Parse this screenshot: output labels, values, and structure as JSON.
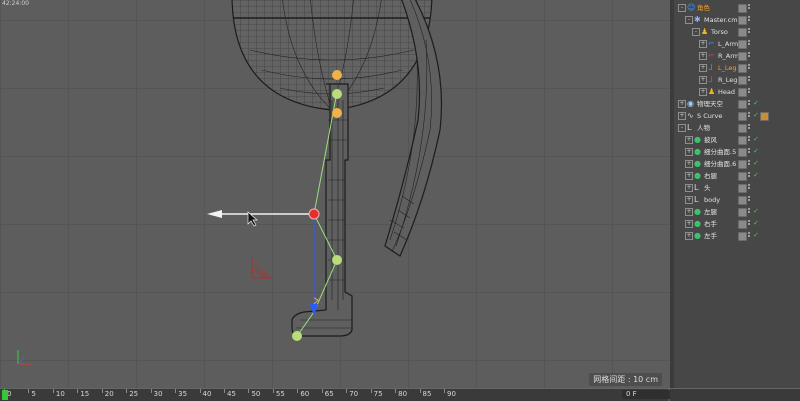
{
  "viewport": {
    "info": "42:24:00",
    "grid_spacing_text": "网格间距 : 10 cm"
  },
  "objects": [
    {
      "label": "角色",
      "color": "#f0a030",
      "icon": "figure-icon",
      "icon_color": "#3aa0ff",
      "depth": 0,
      "expanded": true
    },
    {
      "label": "Master.cmp",
      "color": "#e2e2e2",
      "icon": "star-icon",
      "icon_color": "#8fb6ff",
      "depth": 1,
      "expanded": true
    },
    {
      "label": "Torso",
      "color": "#e2e2e2",
      "icon": "joint-icon",
      "icon_color": "#f4b023",
      "depth": 2,
      "expanded": true
    },
    {
      "label": "L_Arm",
      "color": "#e2e2e2",
      "icon": "limb-icon",
      "icon_color": "#3b8cff",
      "depth": 3
    },
    {
      "label": "R_Arm",
      "color": "#e2e2e2",
      "icon": "limb-icon",
      "icon_color": "#e84040",
      "depth": 3
    },
    {
      "label": "L_Leg",
      "color": "#f0a030",
      "icon": "leg-icon",
      "icon_color": "#3b8cff",
      "depth": 3
    },
    {
      "label": "R_Leg",
      "color": "#e2e2e2",
      "icon": "leg-icon",
      "icon_color": "#e84040",
      "depth": 3
    },
    {
      "label": "Head",
      "color": "#e2e2e2",
      "icon": "joint-icon",
      "icon_color": "#f4b023",
      "depth": 3
    },
    {
      "label": "物理天空",
      "color": "#e2e2e2",
      "icon": "sky-icon",
      "icon_color": "#9fd0ff",
      "depth": 0,
      "check": true
    },
    {
      "label": "S Curve",
      "color": "#e2e2e2",
      "icon": "spline-icon",
      "icon_color": "#cfcfcf",
      "depth": 0,
      "check": true,
      "extra": true
    },
    {
      "label": "人物",
      "color": "#e2e2e2",
      "icon": "null-icon",
      "icon_color": "#d8d8d8",
      "depth": 0,
      "expanded": true
    },
    {
      "label": "披风",
      "color": "#e2e2e2",
      "icon": "green-dot-icon",
      "icon_color": "#39c46a",
      "depth": 1,
      "check": true
    },
    {
      "label": "细分曲面.5",
      "color": "#e2e2e2",
      "icon": "green-dot-icon",
      "icon_color": "#39c46a",
      "depth": 1,
      "check": true
    },
    {
      "label": "细分曲面.6",
      "color": "#e2e2e2",
      "icon": "green-dot-icon",
      "icon_color": "#39c46a",
      "depth": 1,
      "check": true
    },
    {
      "label": "右腿",
      "color": "#e2e2e2",
      "icon": "green-dot-icon",
      "icon_color": "#39c46a",
      "depth": 1,
      "check": true
    },
    {
      "label": "头",
      "color": "#e2e2e2",
      "icon": "null-icon",
      "icon_color": "#d8d8d8",
      "depth": 1
    },
    {
      "label": "body",
      "color": "#e2e2e2",
      "icon": "null-icon",
      "icon_color": "#d8d8d8",
      "depth": 1
    },
    {
      "label": "左腿",
      "color": "#e2e2e2",
      "icon": "green-dot-icon",
      "icon_color": "#39c46a",
      "depth": 1,
      "check": true
    },
    {
      "label": "右手",
      "color": "#e2e2e2",
      "icon": "green-dot-icon",
      "icon_color": "#39c46a",
      "depth": 1,
      "check": true
    },
    {
      "label": "左手",
      "color": "#e2e2e2",
      "icon": "green-dot-icon",
      "icon_color": "#39c46a",
      "depth": 1,
      "check": true
    }
  ],
  "timeline": {
    "ticks": [
      "0",
      "5",
      "10",
      "15",
      "20",
      "25",
      "30",
      "35",
      "40",
      "45",
      "50",
      "55",
      "60",
      "65",
      "70",
      "75",
      "80",
      "85",
      "90"
    ],
    "frame": "0 F",
    "current_frame": 0,
    "playhead_color": "#39c73a"
  },
  "colors": {
    "joint_orange": "#f0b04a",
    "joint_green": "#b9dd7a",
    "handle_red": "#e03030",
    "axis_blue": "#2a5bff"
  }
}
